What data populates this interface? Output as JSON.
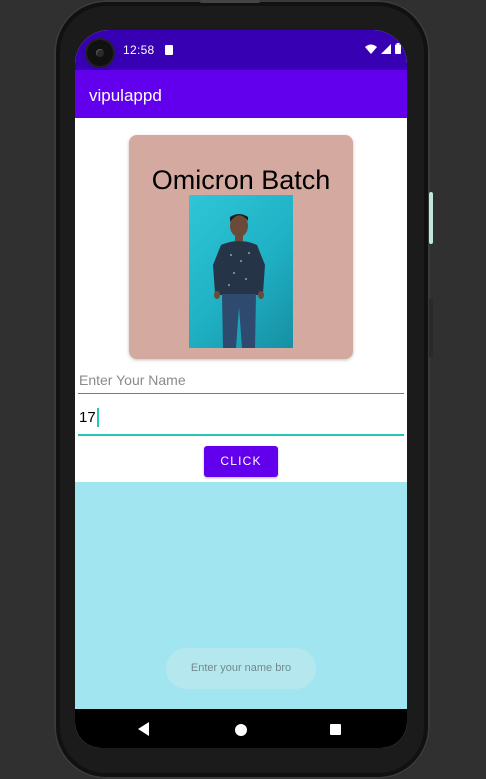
{
  "status_bar": {
    "time": "12:58",
    "icons": [
      "sd-card-icon",
      "wifi-icon",
      "signal-icon",
      "battery-icon"
    ]
  },
  "app_bar": {
    "title": "vipulappd"
  },
  "card": {
    "title": "Omicron Batch",
    "image": "profile-photo"
  },
  "form": {
    "name_placeholder": "Enter Your Name",
    "age_value": "17",
    "button_label": "CLICK"
  },
  "toast": {
    "text": "Enter your name bro"
  },
  "nav_bar": {
    "icons": [
      "back-icon",
      "home-icon",
      "recents-icon"
    ]
  },
  "colors": {
    "status_bar": "#3700b3",
    "app_bar": "#6200ee",
    "card": "#d4aaa0",
    "bottom_panel": "#a1e5f0",
    "accent": "#26c6b6"
  }
}
